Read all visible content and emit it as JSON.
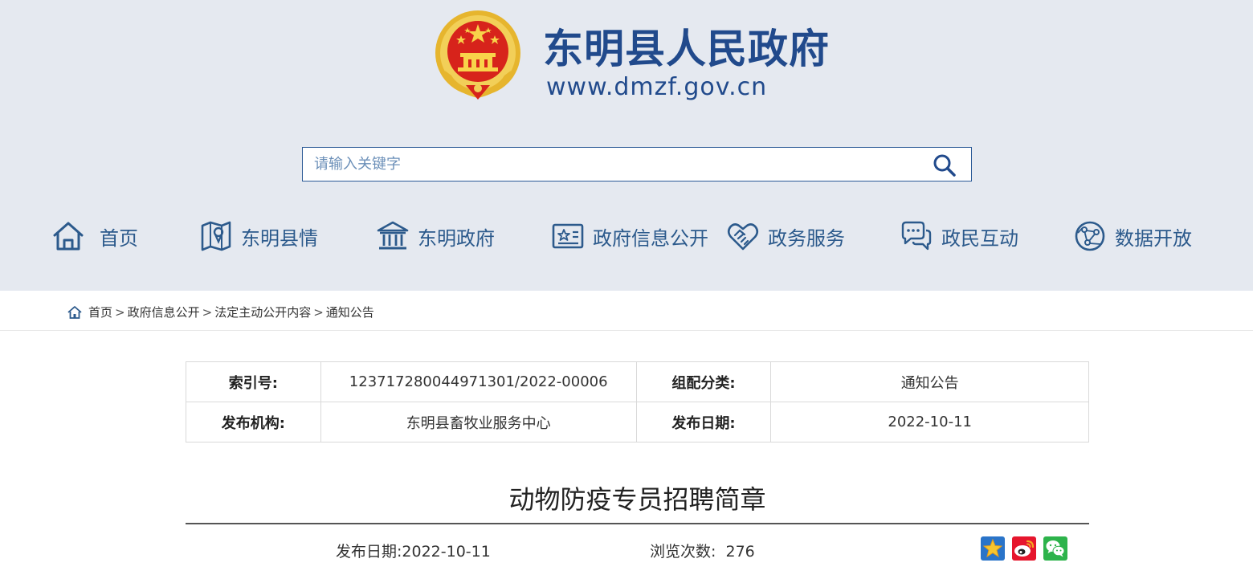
{
  "header": {
    "site_title": "东明县人民政府",
    "site_url": "www.dmzf.gov.cn",
    "brand_color": "#214a8c",
    "emblem_icon": "national-emblem-icon"
  },
  "search": {
    "placeholder": "请输入关键字",
    "value": "",
    "icon": "search-icon"
  },
  "nav": {
    "items": [
      {
        "label": "首页",
        "icon": "home-icon"
      },
      {
        "label": "东明县情",
        "icon": "map-icon"
      },
      {
        "label": "东明政府",
        "icon": "government-building-icon"
      },
      {
        "label": "政府信息公开",
        "icon": "info-card-icon"
      },
      {
        "label": "政务服务",
        "icon": "handshake-heart-icon"
      },
      {
        "label": "政民互动",
        "icon": "chat-bubbles-icon"
      },
      {
        "label": "数据开放",
        "icon": "globe-network-icon"
      }
    ]
  },
  "breadcrumb": {
    "items": [
      "首页",
      "政府信息公开",
      "法定主动公开内容",
      "通知公告"
    ],
    "separator": ">"
  },
  "meta": {
    "index_label": "索引号:",
    "index_value": "12371728004497130​1/2022-00006",
    "category_label": "组配分类:",
    "category_value": "通知公告",
    "publisher_label": "发布机构:",
    "publisher_value": "东明县畜牧业服务中心",
    "date_label": "发布日期:",
    "date_value": "2022-10-11"
  },
  "article": {
    "title": "动物防疫专员招聘简章",
    "publish_date_label": "发布日期:",
    "publish_date": "2022-10-11",
    "views_label": "浏览次数:",
    "views": "276"
  },
  "share": {
    "icons": [
      "favorite-star-icon",
      "weibo-icon",
      "wechat-icon"
    ]
  }
}
